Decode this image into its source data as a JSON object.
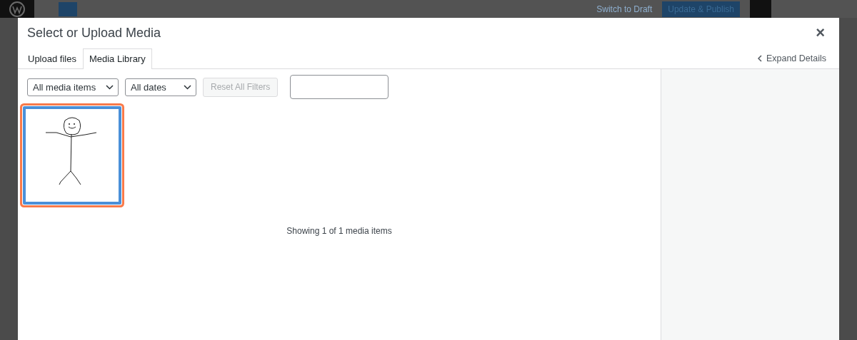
{
  "editor": {
    "switch_link": "Switch to Draft",
    "publish_button": "Update & Publish"
  },
  "modal": {
    "title": "Select or Upload Media",
    "close": "×",
    "tabs": [
      {
        "label": "Upload files",
        "selected": false
      },
      {
        "label": "Media Library",
        "selected": true
      }
    ],
    "expand_details": "Expand Details",
    "filters": {
      "type_dropdown": "All media items",
      "date_dropdown": "All dates",
      "reset_button": "Reset All Filters",
      "reset_disabled": true
    },
    "media_items": [
      {
        "kind": "drawing",
        "selected": true
      }
    ],
    "status": "Showing 1 of 1 media items"
  }
}
